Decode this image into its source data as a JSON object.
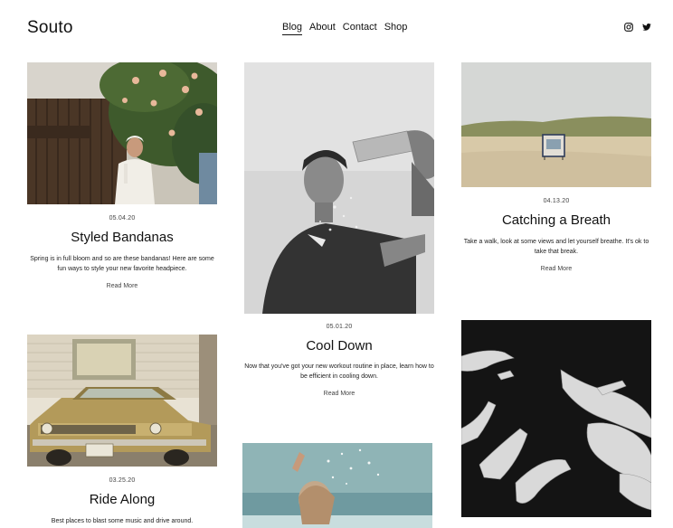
{
  "header": {
    "brand": "Souto",
    "nav": [
      {
        "label": "Blog",
        "active": true
      },
      {
        "label": "About"
      },
      {
        "label": "Contact"
      },
      {
        "label": "Shop"
      }
    ],
    "social": [
      "instagram-icon",
      "twitter-icon"
    ]
  },
  "posts": [
    {
      "date": "05.04.20",
      "title": "Styled Bandanas",
      "excerpt": "Spring is in full bloom and so are these bandanas! Here are some fun ways to style your new favorite headpiece.",
      "more": "Read More"
    },
    {
      "date": "05.01.20",
      "title": "Cool Down",
      "excerpt": "Now that you've got your new workout routine in place, learn how to be efficient in cooling down.",
      "more": "Read More"
    },
    {
      "date": "04.13.20",
      "title": "Catching a Breath",
      "excerpt": "Take a walk, look at some views and let yourself breathe. It's ok to take that break.",
      "more": "Read More"
    },
    {
      "date": "03.25.20",
      "title": "Ride Along",
      "excerpt": "Best places to blast some music and drive around."
    }
  ],
  "colors": {
    "text": "#111111",
    "muted": "#444444",
    "background": "#ffffff"
  }
}
